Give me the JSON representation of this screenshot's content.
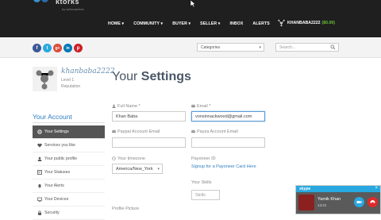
{
  "logo": {
    "text": "ktorks",
    "sub": "by webcoaches"
  },
  "nav": {
    "items": [
      "HOME ▾",
      "COMMUNITY ▾",
      "BUYER ▾",
      "SELLER ▾",
      "INBOX",
      "ALERTS"
    ],
    "username": "KHANBABA2222",
    "balance": "($0.00)"
  },
  "social": [
    "f",
    "t",
    "g+",
    "in",
    "p"
  ],
  "colors": {
    "facebook": "#3b5998",
    "twitter": "#29a8e0",
    "google": "#dd4b39",
    "linkedin": "#0077b5",
    "pinterest": "#cb2027",
    "accent": "#2f7ec0",
    "topbar": "#1f1f1f"
  },
  "subbar": {
    "category": "Categories",
    "search_placeholder": "Search..."
  },
  "profile": {
    "name": "khanbaba2222",
    "level": "Level 1",
    "reputation": "Reputation"
  },
  "sidebar": {
    "title": "Your Account",
    "items": [
      {
        "label": "Your Settings",
        "icon": "gear-icon",
        "active": true
      },
      {
        "label": "Services you like",
        "icon": "heart-icon",
        "active": false
      },
      {
        "label": "Your public profile",
        "icon": "user-icon",
        "active": false
      },
      {
        "label": "Your Statuses",
        "icon": "status-icon",
        "active": false
      },
      {
        "label": "Your Alerts",
        "icon": "bell-icon",
        "active": false
      },
      {
        "label": "Your Devices",
        "icon": "device-icon",
        "active": false
      },
      {
        "label": "Security",
        "icon": "lock-icon",
        "active": false
      }
    ]
  },
  "main": {
    "heading_pre": "Your ",
    "heading_bold": "Settings",
    "full_name_label": "Full Name *",
    "full_name_value": "Khan Baba",
    "email_label": "Email *",
    "email_value": "vonsinnackwood@gmail.com",
    "paypal_label": "Paypal Account Email",
    "payza_label": "Payza Account Email",
    "timezone_label": "Your timezone",
    "timezone_value": "America/New_York",
    "payoneer_label": "Payoneer ID",
    "payoneer_link": "Signup for a Payoneer Card Here",
    "skills_label": "Your Skills",
    "skills_value": "Skills",
    "profile_picture_label": "Profile Picture"
  },
  "chat": {
    "app": "skype",
    "name": "Yamik Khan",
    "time": "13:21"
  }
}
